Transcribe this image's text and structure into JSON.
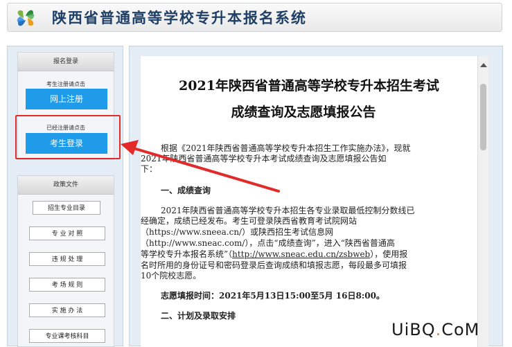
{
  "header": {
    "site_title": "陕西省普通高等学校专升本报名系统"
  },
  "sidebar": {
    "registration_panel": {
      "title": "报名登录",
      "register_hint": "考生注册请点击",
      "register_button": "网上注册",
      "login_hint": "已经注册请点击",
      "login_button": "考生登录"
    },
    "policy_panel": {
      "title": "政策文件",
      "items": [
        "招生专业目录",
        "专 业 对 照",
        "违 规 处 理",
        "考 场 规 则",
        "实 施 办 法",
        "专业课考核科目"
      ]
    }
  },
  "document": {
    "title_line1": "2021年陕西省普通高等学校专升本招生考试",
    "title_line2": "成绩查询及志愿填报公告",
    "intro_line1": "根据《2021年陕西省普通高等学校专升本招生工作实施办法》，现就",
    "intro_line2": "2021年陕西省普通高等学校专升本考试成绩查询及志愿填报公告如",
    "intro_line3": "下：",
    "section1_heading": "一、成绩查询",
    "s1_line1": "2021年陕西省普通高等学校专升本招生各专业录取最低控制分数线已",
    "s1_line2": "经确定，成绩已经发布。考生可登录陕西省教育考试院网站",
    "s1_line3": "（https://www.sneea.cn/）或陕西招生考试信息网",
    "s1_line4": "（http://www.sneac.com/），点击“成绩查询”，进入“陕西省普通高",
    "s1_line5_prefix": "等学校专升本报名系统”（",
    "s1_line5_link": "http://www.sneac.edu.cn/zsbweb",
    "s1_line5_suffix": "），使用报",
    "s1_line6": "名时所用的身份证号和密码登录后查询成绩和填报志愿，每段最多可填报",
    "s1_line7": "10个院校志愿。",
    "deadline": "志愿填报时间：2021年5月13日15:00至5月 16日8:00。",
    "section2_heading": "二、计划及录取安排"
  },
  "watermark": {
    "prefix": "UiBQ",
    "dot": ".",
    "suffix": "CoM"
  },
  "colors": {
    "button_blue": "#1f9bea",
    "highlight_red": "#e32a2a",
    "title_navy": "#1f3f66"
  }
}
